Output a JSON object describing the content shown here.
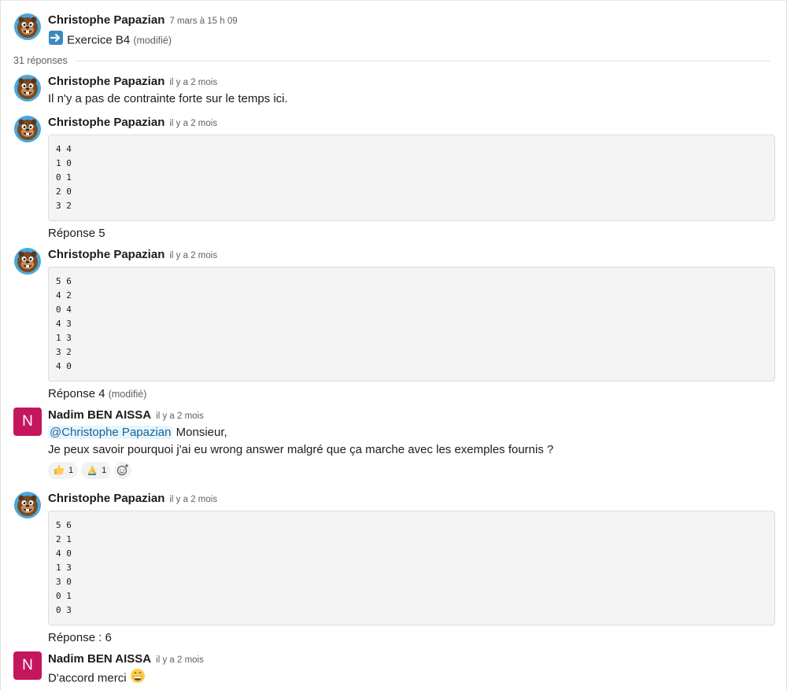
{
  "thread": {
    "parent": {
      "author": "Christophe Papazian",
      "time": "7 mars à 15 h 09",
      "text": "Exercice B4",
      "edited": "(modifié)"
    },
    "replies_count": "31 réponses"
  },
  "messages": [
    {
      "author": "Christophe Papazian",
      "time": "il y a 2 mois",
      "text": "Il n'y a pas de contrainte forte sur le temps ici."
    },
    {
      "author": "Christophe Papazian",
      "time": "il y a 2 mois",
      "code": [
        "4 4",
        "1 0",
        "0 1",
        "2 0",
        "3 2"
      ],
      "after": "Réponse 5"
    },
    {
      "author": "Christophe Papazian",
      "time": "il y a 2 mois",
      "code": [
        "5 6",
        "4 2",
        "0 4",
        "4 3",
        "1 3",
        "3 2",
        "4 0"
      ],
      "after": "Réponse 4",
      "after_edited": "(modifié)"
    },
    {
      "author": "Nadim BEN AISSA",
      "avatar_letter": "N",
      "time": "il y a 2 mois",
      "mention": "@Christophe Papazian",
      "text1": "Monsieur,",
      "text2": "Je peux savoir pourquoi j'ai eu wrong answer malgré que ça marche avec les exemples fournis ?",
      "reactions": [
        {
          "emoji": "thumbs-up",
          "count": "1"
        },
        {
          "emoji": "folded-hands",
          "count": "1"
        }
      ]
    },
    {
      "author": "Christophe Papazian",
      "time": "il y a 2 mois",
      "code": [
        "5 6",
        "2 1",
        "4 0",
        "1 3",
        "3 0",
        "0 1",
        "0 3"
      ],
      "after": "Réponse : 6"
    },
    {
      "author": "Nadim BEN AISSA",
      "avatar_letter": "N",
      "time": "il y a 2 mois",
      "text": "D'accord merci"
    }
  ],
  "colors": {
    "mention_bg": "#e8f5fa",
    "mention_text": "#1264a3",
    "avatar_n": "#c4165d"
  }
}
